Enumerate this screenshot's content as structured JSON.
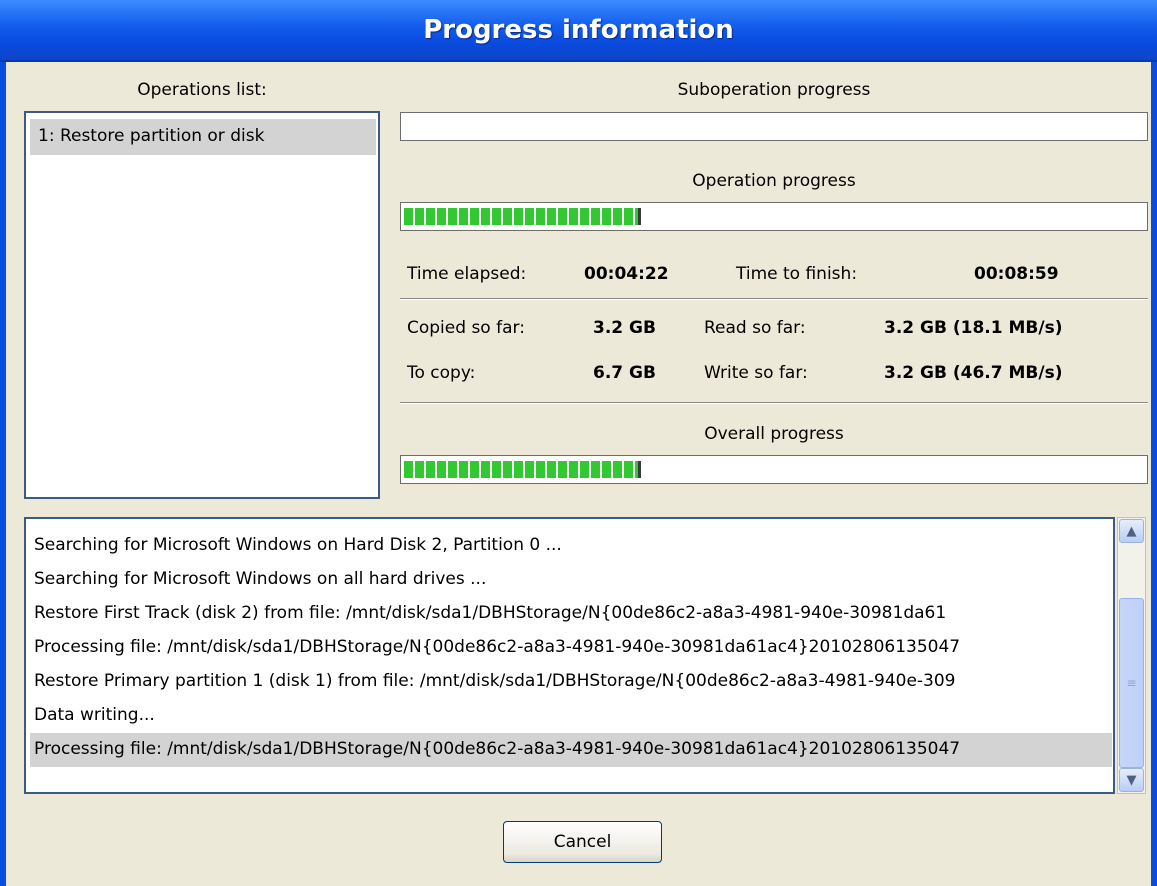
{
  "title": "Progress information",
  "operations": {
    "label": "Operations list:",
    "items": [
      "1: Restore partition or disk"
    ]
  },
  "suboperation": {
    "label": "Suboperation progress",
    "progress": 0
  },
  "operation": {
    "label": "Operation progress",
    "progress": 0.32
  },
  "stats": {
    "time_elapsed_label": "Time elapsed:",
    "time_elapsed": "00:04:22",
    "time_to_finish_label": "Time to finish:",
    "time_to_finish": "00:08:59",
    "copied_label": "Copied so far:",
    "copied": "3.2 GB",
    "to_copy_label": "To copy:",
    "to_copy": "6.7 GB",
    "read_label": "Read so far:",
    "read": "3.2 GB (18.1 MB/s)",
    "write_label": "Write so far:",
    "write": "3.2 GB (46.7 MB/s)"
  },
  "overall": {
    "label": "Overall progress",
    "progress": 0.32
  },
  "log": [
    "Searching for Microsoft Windows on Hard Disk 2, Partition 0 ...",
    "Searching for Microsoft Windows on all hard drives ...",
    "Restore First Track (disk 2) from file: /mnt/disk/sda1/DBHStorage/N{00de86c2-a8a3-4981-940e-30981da61",
    "Processing file: /mnt/disk/sda1/DBHStorage/N{00de86c2-a8a3-4981-940e-30981da61ac4}20102806135047",
    "Restore Primary partition 1 (disk 1) from file: /mnt/disk/sda1/DBHStorage/N{00de86c2-a8a3-4981-940e-309",
    "Data writing...",
    "Processing file: /mnt/disk/sda1/DBHStorage/N{00de86c2-a8a3-4981-940e-30981da61ac4}20102806135047"
  ],
  "cancel_label": "Cancel",
  "icons": {
    "scroll_up": "chevron-up-icon",
    "scroll_down": "chevron-down-icon"
  }
}
